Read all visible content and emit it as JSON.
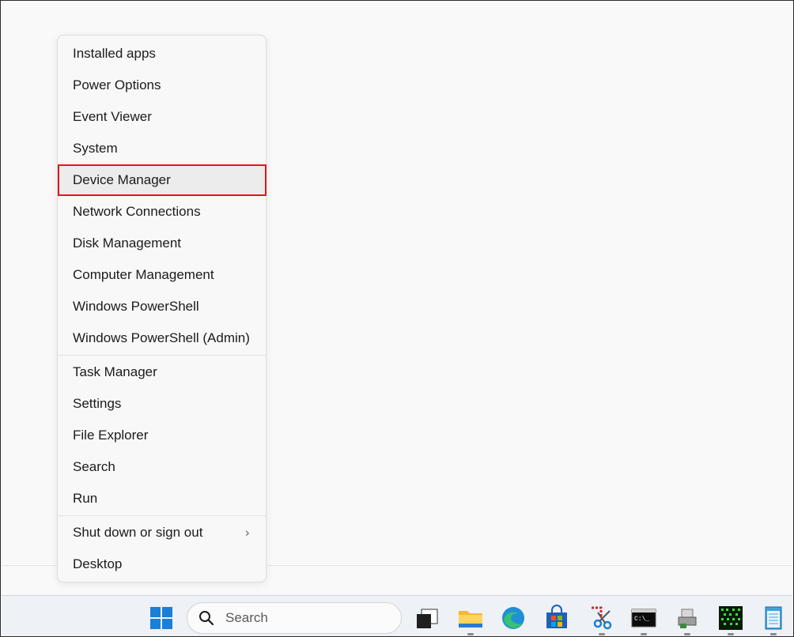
{
  "menu": {
    "group1": [
      {
        "label": "Installed apps"
      },
      {
        "label": "Power Options"
      },
      {
        "label": "Event Viewer"
      },
      {
        "label": "System"
      },
      {
        "label": "Device Manager"
      },
      {
        "label": "Network Connections"
      },
      {
        "label": "Disk Management"
      },
      {
        "label": "Computer Management"
      },
      {
        "label": "Windows PowerShell"
      },
      {
        "label": "Windows PowerShell (Admin)"
      }
    ],
    "group2": [
      {
        "label": "Task Manager"
      },
      {
        "label": "Settings"
      },
      {
        "label": "File Explorer"
      },
      {
        "label": "Search"
      },
      {
        "label": "Run"
      }
    ],
    "group3": [
      {
        "label": "Shut down or sign out",
        "submenu_icon": "chevron-right-icon"
      },
      {
        "label": "Desktop"
      }
    ],
    "highlighted_item": "Device Manager",
    "highlight_color": "#e0161d"
  },
  "taskbar": {
    "search_placeholder": "Search",
    "icons": [
      "windows-start-icon",
      "search-icon",
      "task-view-icon",
      "file-explorer-icon",
      "edge-icon",
      "microsoft-store-icon",
      "snipping-tool-icon",
      "command-prompt-icon",
      "device-icon",
      "terminal-green-icon",
      "notepad-icon"
    ]
  }
}
